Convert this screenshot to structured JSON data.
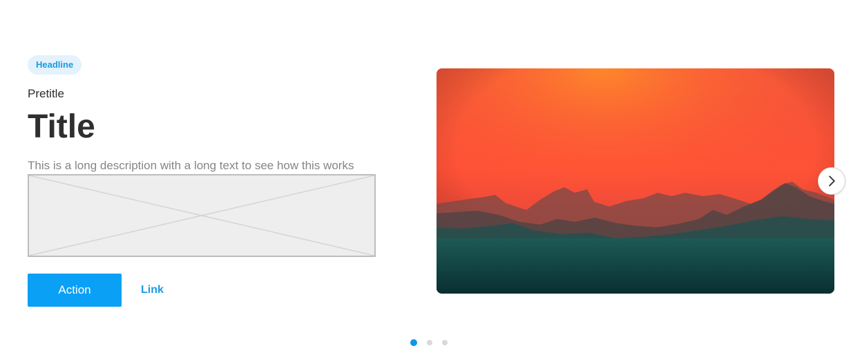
{
  "hero": {
    "headline": "Headline",
    "pretitle": "Pretitle",
    "title": "Title",
    "description": "This is a long description with a long text to see how this works",
    "action_label": "Action",
    "link_label": "Link"
  },
  "carousel": {
    "next_icon": "chevron-right-icon",
    "slide_count": 3,
    "active_slide": 1
  },
  "colors": {
    "accent": "#0aa0f5",
    "link": "#1a9ae0",
    "badge_bg": "#e3f2fc",
    "dot_active": "#0d98e6",
    "dot_inactive": "#d9d9d9"
  }
}
